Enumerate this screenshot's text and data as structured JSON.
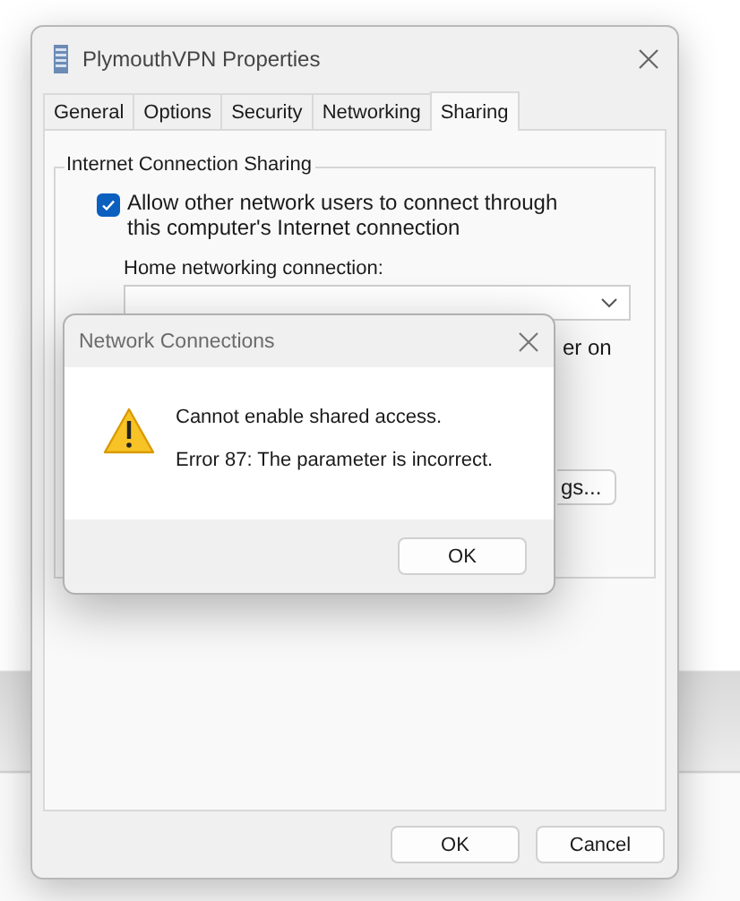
{
  "window": {
    "title": "PlymouthVPN Properties"
  },
  "tabs": [
    {
      "label": "General",
      "selected": false
    },
    {
      "label": "Options",
      "selected": false
    },
    {
      "label": "Security",
      "selected": false
    },
    {
      "label": "Networking",
      "selected": false
    },
    {
      "label": "Sharing",
      "selected": true
    }
  ],
  "group": {
    "title": "Internet Connection Sharing",
    "allow_checkbox": {
      "label": "Allow other network users to connect through this computer's Internet connection",
      "checked": true
    },
    "home_connection_label": "Home networking connection:",
    "partial_text": "er on",
    "partial_button": "gs..."
  },
  "buttons": [
    "OK",
    "Cancel"
  ],
  "dialog": {
    "title": "Network Connections",
    "messages": [
      "Cannot enable shared access.",
      "Error 87: The parameter is incorrect."
    ],
    "button": "OK"
  }
}
